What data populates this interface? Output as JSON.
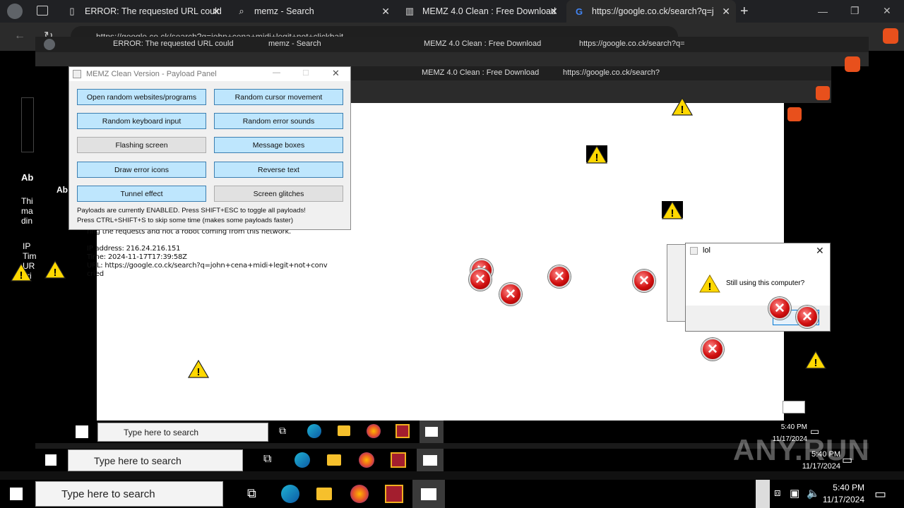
{
  "outer_tabs": [
    {
      "label": "ERROR: The requested URL could",
      "icon": "page-icon"
    },
    {
      "label": "memz - Search",
      "icon": "search-icon"
    },
    {
      "label": "MEMZ 4.0 Clean : Free Download",
      "icon": "archive-icon"
    },
    {
      "label": "https://google.co.ck/search?q=j",
      "icon": "google-icon"
    }
  ],
  "outer_address": "https://google.co.ck/search?q=john+cena+midi+legit+not+clickbait",
  "nested_tabs_1": [
    {
      "label": "ERROR: The requested URL could"
    },
    {
      "label": "memz - Search"
    },
    {
      "label": "MEMZ 4.0 Clean : Free Download"
    },
    {
      "label": "https://google.co.ck/search?q="
    }
  ],
  "nested_tabs_2": [
    {
      "label": "MEMZ 4.0 Clean : Free Download"
    },
    {
      "label": "https://google.co.ck/search?"
    }
  ],
  "panel": {
    "title": "MEMZ Clean Version - Payload Panel",
    "buttons": [
      {
        "label": "Open random websites/programs",
        "enabled": true
      },
      {
        "label": "Random cursor movement",
        "enabled": true
      },
      {
        "label": "Random keyboard input",
        "enabled": true
      },
      {
        "label": "Random error sounds",
        "enabled": true
      },
      {
        "label": "Flashing screen",
        "enabled": false
      },
      {
        "label": "Message boxes",
        "enabled": true
      },
      {
        "label": "Draw error icons",
        "enabled": true
      },
      {
        "label": "Reverse text",
        "enabled": true
      },
      {
        "label": "Tunnel effect",
        "enabled": true
      },
      {
        "label": "Screen glitches",
        "enabled": false
      }
    ],
    "info_line1": "Payloads are currently ENABLED. Press SHIFT+ESC to toggle all payloads!",
    "info_line2": "Press CTRL+SHIFT+S to skip some time (makes some payloads faster)"
  },
  "error_page": {
    "partial_line": "ring the requests and not a robot coming from this network.",
    "ip": "IP address: 216.24.216.151",
    "time": "Time: 2024-11-17T17:39:58Z",
    "url": "URL: https://google.co.ck/search?q=john+cena+midi+legit+not+conv",
    "url_cont": "cried",
    "left_fragments": [
      "Ab",
      "Thi",
      "ma",
      "din",
      "IP",
      "Tim",
      "UR",
      "cri"
    ]
  },
  "msgbox": {
    "title": "lol",
    "message": "Still using this computer?"
  },
  "taskbars": [
    {
      "search_placeholder": "Type here to search",
      "time": "5:40 PM",
      "date": "11/17/2024"
    },
    {
      "search_placeholder": "Type here to search",
      "time": "5:40 PM",
      "date": "11/17/2024"
    },
    {
      "search_placeholder": "Type here to search",
      "time": "5:40 PM",
      "date": "11/17/2024"
    }
  ],
  "watermark": "ANY.RUN",
  "colors": {
    "accent_blue": "#0078d4",
    "error_red": "#d21010",
    "warning_yellow": "#ffd800",
    "button_blue": "#bee6fd"
  }
}
